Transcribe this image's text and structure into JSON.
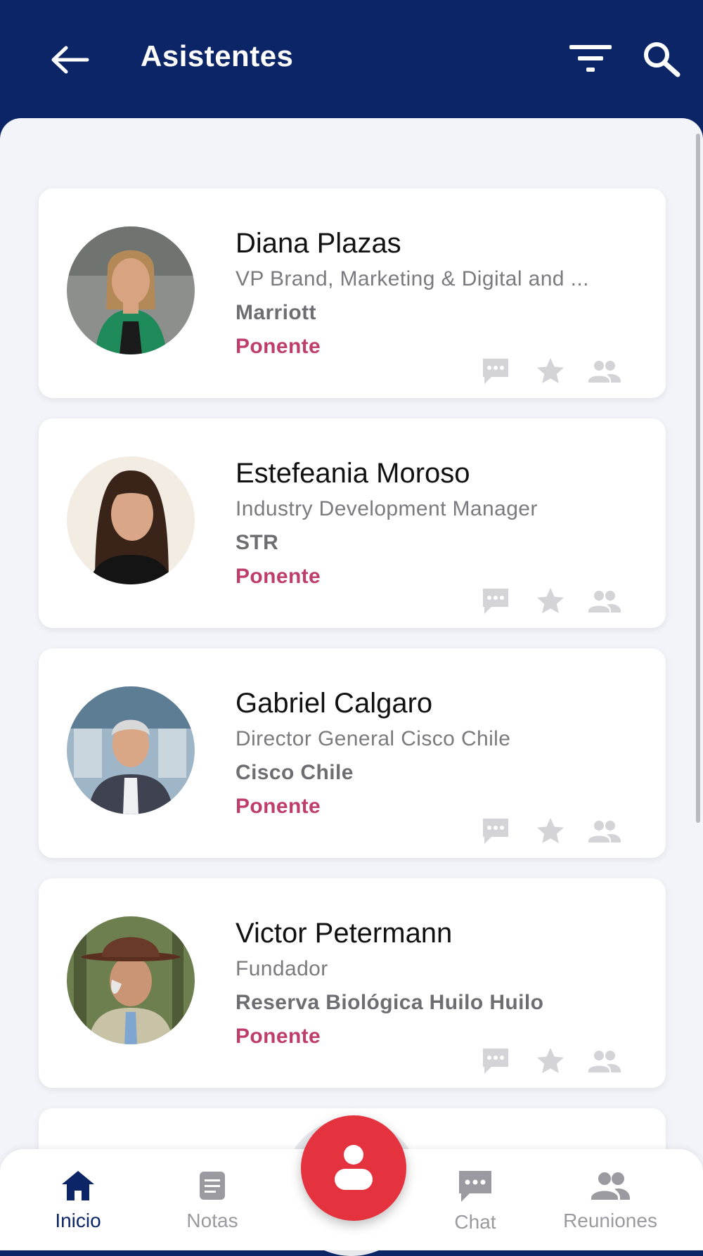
{
  "header": {
    "title": "Asistentes",
    "back_icon": "arrow-left-icon",
    "filter_icon": "filter-icon",
    "search_icon": "search-icon"
  },
  "attendees": [
    {
      "name": "Diana Plazas",
      "role": "VP Brand, Marketing & Digital and ...",
      "company": "Marriott",
      "type": "Ponente"
    },
    {
      "name": "Estefeania Moroso",
      "role": "Industry Development Manager",
      "company": "STR",
      "type": "Ponente"
    },
    {
      "name": "Gabriel Calgaro",
      "role": "Director General Cisco Chile",
      "company": "Cisco Chile",
      "type": "Ponente"
    },
    {
      "name": "Victor Petermann",
      "role": "Fundador",
      "company": "Reserva Biológica Huilo Huilo",
      "type": "Ponente"
    }
  ],
  "bottom_nav": {
    "items": [
      {
        "label": "Inicio",
        "icon": "home-icon",
        "active": true
      },
      {
        "label": "Notas",
        "icon": "notes-icon",
        "active": false
      },
      {
        "label": "Chat",
        "icon": "chat-icon",
        "active": false
      },
      {
        "label": "Reuniones",
        "icon": "people-icon",
        "active": false
      }
    ],
    "fab_icon": "person-icon"
  },
  "colors": {
    "header_bg": "#0b2566",
    "accent_type": "#bf3d6c",
    "fab": "#e4323f",
    "active_nav": "#0b2566"
  }
}
